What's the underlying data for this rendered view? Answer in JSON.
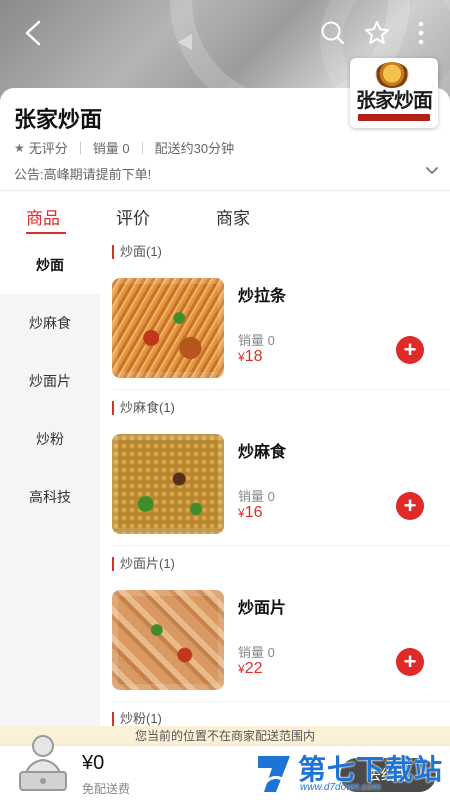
{
  "shop": {
    "name": "张家炒面",
    "logo_text": "张家炒面",
    "rating": "无评分",
    "sales": "销量 0",
    "delivery": "配送约30分钟",
    "notice": "公告:高峰期请提前下单!"
  },
  "tabs": [
    {
      "label": "商品",
      "active": true
    },
    {
      "label": "评价",
      "active": false
    },
    {
      "label": "商家",
      "active": false
    }
  ],
  "sidebar": [
    {
      "label": "炒面",
      "active": true
    },
    {
      "label": "炒麻食",
      "active": false
    },
    {
      "label": "炒面片",
      "active": false
    },
    {
      "label": "炒粉",
      "active": false
    },
    {
      "label": "高科技",
      "active": false
    }
  ],
  "sections": [
    {
      "title": "炒面(1)",
      "item": {
        "name": "炒拉条",
        "sales": "销量 0",
        "currency": "¥",
        "price": "18"
      }
    },
    {
      "title": "炒麻食(1)",
      "item": {
        "name": "炒麻食",
        "sales": "销量 0",
        "currency": "¥",
        "price": "16"
      }
    },
    {
      "title": "炒面片(1)",
      "item": {
        "name": "炒面片",
        "sales": "销量 0",
        "currency": "¥",
        "price": "22"
      }
    },
    {
      "title": "炒粉(1)"
    }
  ],
  "add_label": "+",
  "footer": {
    "warning": "您当前的位置不在商家配送范围内",
    "total": "¥0",
    "free_delivery": "免配送费",
    "checkout": "去结算"
  },
  "watermark": {
    "text": "第七下载站",
    "url": "www.d7down.com"
  },
  "colors": {
    "accent": "#d9302a",
    "add_button": "#e02a2a",
    "checkout_bg": "#4a4a4a",
    "warning_bg": "#fbf1d6",
    "watermark": "#1e73d6"
  }
}
